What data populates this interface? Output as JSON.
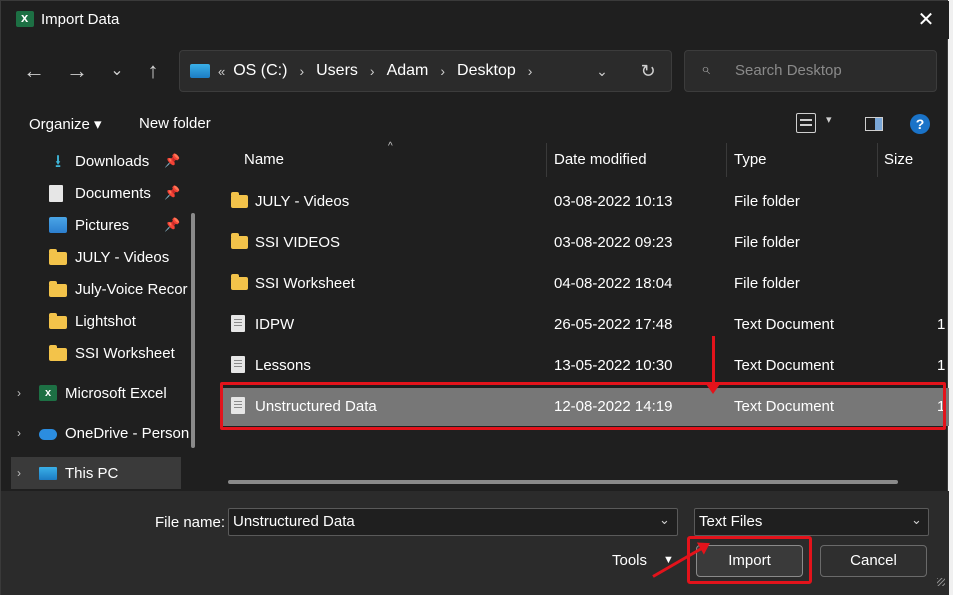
{
  "window": {
    "title": "Import Data",
    "close": "✕"
  },
  "nav": {
    "back": "←",
    "forward": "→",
    "recent": "⌄",
    "up": "↑",
    "chevrons": "«",
    "crumbs": [
      "OS (C:)",
      "Users",
      "Adam",
      "Desktop"
    ],
    "crumb_sep": "›",
    "dropdown": "⌄",
    "refresh": "↻"
  },
  "search": {
    "placeholder": "Search Desktop",
    "icon": "⌕"
  },
  "toolbar": {
    "organize": "Organize ▾",
    "new_folder": "New folder",
    "view_dd": "▾",
    "help": "?"
  },
  "sidebar": {
    "items": [
      {
        "label": "Downloads",
        "icon": "download-icon",
        "pinned": true
      },
      {
        "label": "Documents",
        "icon": "document-icon",
        "pinned": true
      },
      {
        "label": "Pictures",
        "icon": "pictures-icon",
        "pinned": true
      },
      {
        "label": "JULY - Videos",
        "icon": "folder-icon"
      },
      {
        "label": "July-Voice Recor",
        "icon": "folder-icon"
      },
      {
        "label": "Lightshot",
        "icon": "folder-icon"
      },
      {
        "label": "SSI Worksheet",
        "icon": "folder-icon"
      },
      {
        "label": "Microsoft Excel",
        "icon": "excel-icon"
      },
      {
        "label": "OneDrive - Person",
        "icon": "onedrive-icon"
      },
      {
        "label": "This PC",
        "icon": "this-pc-icon"
      }
    ],
    "pin": "📌",
    "expand": "›"
  },
  "columns": {
    "name": "Name",
    "date": "Date modified",
    "type": "Type",
    "size": "Size",
    "sort": "^"
  },
  "files": [
    {
      "name": "JULY - Videos",
      "date": "03-08-2022 10:13",
      "type": "File folder",
      "size": ""
    },
    {
      "name": "SSI VIDEOS",
      "date": "03-08-2022 09:23",
      "type": "File folder",
      "size": ""
    },
    {
      "name": "SSI Worksheet",
      "date": "04-08-2022 18:04",
      "type": "File folder",
      "size": ""
    },
    {
      "name": "IDPW",
      "date": "26-05-2022 17:48",
      "type": "Text Document",
      "size": "1"
    },
    {
      "name": "Lessons",
      "date": "13-05-2022 10:30",
      "type": "Text Document",
      "size": "1"
    },
    {
      "name": "Unstructured Data",
      "date": "12-08-2022 14:19",
      "type": "Text Document",
      "size": "1"
    }
  ],
  "footer": {
    "file_name_label": "File name:",
    "file_name_value": "Unstructured Data",
    "file_type": "Text Files",
    "dd": "⌄",
    "tools": "Tools",
    "tools_dd": "▼",
    "import": "Import",
    "cancel": "Cancel"
  },
  "colors": {
    "accent": "#e3131b",
    "selected_row": "#777777",
    "background": "#1f1f1f"
  }
}
